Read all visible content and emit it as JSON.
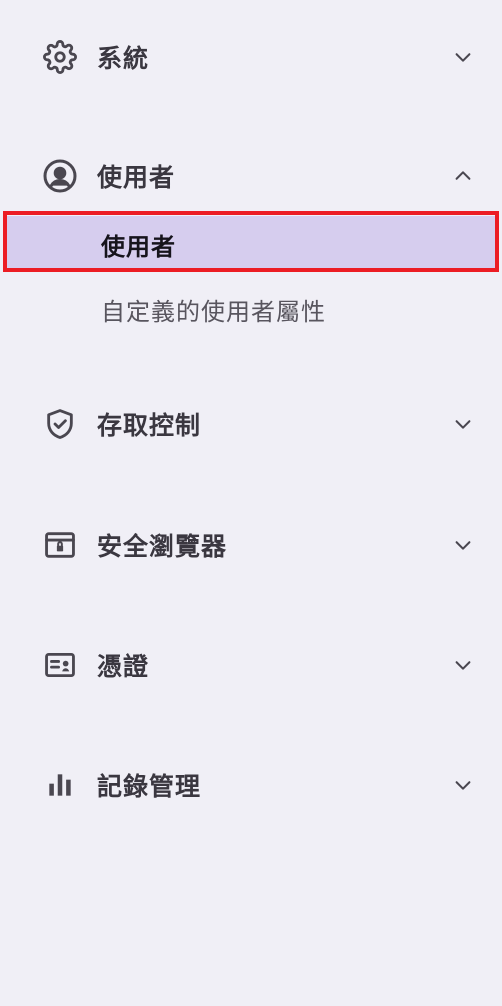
{
  "sidebar": {
    "sections": [
      {
        "label": "系統",
        "icon": "gear-icon",
        "expanded": false
      },
      {
        "label": "使用者",
        "icon": "user-circle-icon",
        "expanded": true,
        "items": [
          {
            "label": "使用者",
            "active": true
          },
          {
            "label": "自定義的使用者屬性",
            "active": false
          }
        ]
      },
      {
        "label": "存取控制",
        "icon": "shield-check-icon",
        "expanded": false
      },
      {
        "label": "安全瀏覽器",
        "icon": "browser-lock-icon",
        "expanded": false
      },
      {
        "label": "憑證",
        "icon": "id-card-icon",
        "expanded": false
      },
      {
        "label": "記錄管理",
        "icon": "bar-chart-icon",
        "expanded": false
      }
    ]
  },
  "colors": {
    "background": "#f0eff6",
    "active_item_bg": "#d6cdee",
    "highlight_border": "#ec1c24",
    "text": "#3a3740"
  }
}
